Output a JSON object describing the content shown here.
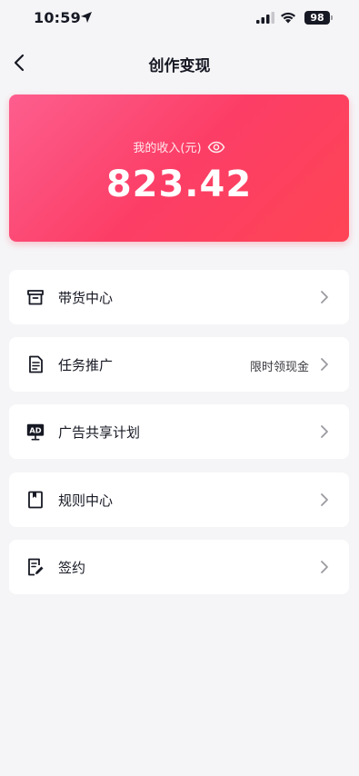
{
  "status_bar": {
    "time": "10:59",
    "battery": "98"
  },
  "nav": {
    "title": "创作变现"
  },
  "income_card": {
    "label": "我的收入(元)",
    "amount": "823.42"
  },
  "menu": [
    {
      "icon": "store-box-icon",
      "label": "带货中心",
      "hint": ""
    },
    {
      "icon": "document-icon",
      "label": "任务推广",
      "hint": "限时领现金"
    },
    {
      "icon": "ad-monitor-icon",
      "label": "广告共享计划",
      "hint": ""
    },
    {
      "icon": "bookmark-book-icon",
      "label": "规则中心",
      "hint": ""
    },
    {
      "icon": "sign-pen-icon",
      "label": "签约",
      "hint": ""
    }
  ],
  "colors": {
    "card_gradient_start": "#fd5e8e",
    "card_gradient_end": "#fe4455",
    "background": "#f5f5f7"
  }
}
